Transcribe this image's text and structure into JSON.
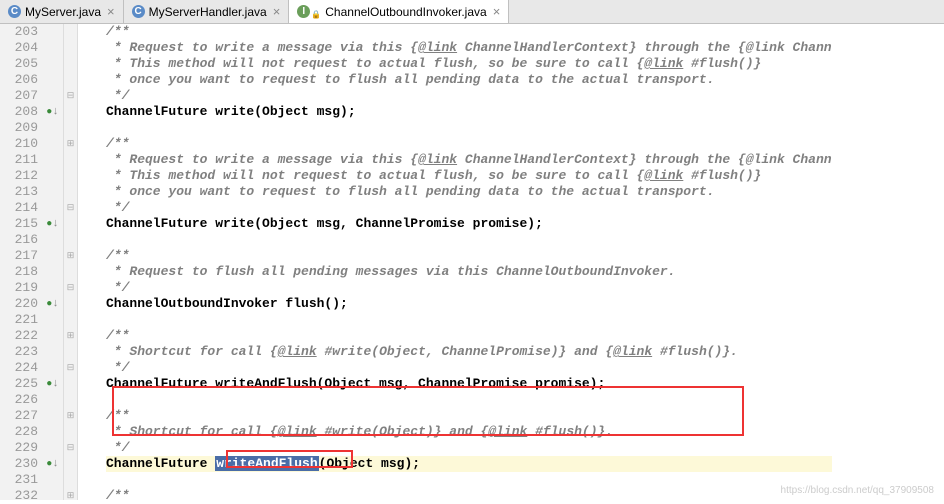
{
  "tabs": [
    {
      "label": "MyServer.java",
      "icon": "c"
    },
    {
      "label": "MyServerHandler.java",
      "icon": "c"
    },
    {
      "label": "ChannelOutboundInvoker.java",
      "icon": "i",
      "active": true
    }
  ],
  "watermark": "https://blog.csdn.net/qq_37909508",
  "lines": [
    {
      "n": "203",
      "m": "",
      "f": "",
      "t": "/**",
      "cls": "comment"
    },
    {
      "n": "204",
      "m": "",
      "f": "",
      "t": " * Request to write a message via this {@link ChannelHandlerContext} through the {@link Chann",
      "cls": "comment",
      "jd": true
    },
    {
      "n": "205",
      "m": "",
      "f": "",
      "t": " * This method will not request to actual flush, so be sure to call {@link #flush()}",
      "cls": "comment",
      "jd": true
    },
    {
      "n": "206",
      "m": "",
      "f": "",
      "t": " * once you want to request to flush all pending data to the actual transport.",
      "cls": "comment"
    },
    {
      "n": "207",
      "m": "",
      "f": "⊟",
      "t": " */",
      "cls": "comment"
    },
    {
      "n": "208",
      "m": "o↓",
      "f": "",
      "t": "ChannelFuture write(Object msg);",
      "cls": "code"
    },
    {
      "n": "209",
      "m": "",
      "f": "",
      "t": "",
      "cls": "code"
    },
    {
      "n": "210",
      "m": "",
      "f": "⊞",
      "t": "/**",
      "cls": "comment"
    },
    {
      "n": "211",
      "m": "",
      "f": "",
      "t": " * Request to write a message via this {@link ChannelHandlerContext} through the {@link Chann",
      "cls": "comment",
      "jd": true
    },
    {
      "n": "212",
      "m": "",
      "f": "",
      "t": " * This method will not request to actual flush, so be sure to call {@link #flush()}",
      "cls": "comment",
      "jd": true
    },
    {
      "n": "213",
      "m": "",
      "f": "",
      "t": " * once you want to request to flush all pending data to the actual transport.",
      "cls": "comment"
    },
    {
      "n": "214",
      "m": "",
      "f": "⊟",
      "t": " */",
      "cls": "comment"
    },
    {
      "n": "215",
      "m": "o↓",
      "f": "",
      "t": "ChannelFuture write(Object msg, ChannelPromise promise);",
      "cls": "code"
    },
    {
      "n": "216",
      "m": "",
      "f": "",
      "t": "",
      "cls": "code"
    },
    {
      "n": "217",
      "m": "",
      "f": "⊞",
      "t": "/**",
      "cls": "comment"
    },
    {
      "n": "218",
      "m": "",
      "f": "",
      "t": " * Request to flush all pending messages via this ChannelOutboundInvoker.",
      "cls": "comment"
    },
    {
      "n": "219",
      "m": "",
      "f": "⊟",
      "t": " */",
      "cls": "comment"
    },
    {
      "n": "220",
      "m": "o↓",
      "f": "",
      "t": "ChannelOutboundInvoker flush();",
      "cls": "code"
    },
    {
      "n": "221",
      "m": "",
      "f": "",
      "t": "",
      "cls": "code"
    },
    {
      "n": "222",
      "m": "",
      "f": "⊞",
      "t": "/**",
      "cls": "comment"
    },
    {
      "n": "223",
      "m": "",
      "f": "",
      "t": " * Shortcut for call {@link #write(Object, ChannelPromise)} and {@link #flush()}.",
      "cls": "comment",
      "jd": true
    },
    {
      "n": "224",
      "m": "",
      "f": "⊟",
      "t": " */",
      "cls": "comment"
    },
    {
      "n": "225",
      "m": "o↓",
      "f": "",
      "t": "ChannelFuture writeAndFlush(Object msg, ChannelPromise promise);",
      "cls": "code"
    },
    {
      "n": "226",
      "m": "",
      "f": "",
      "t": "",
      "cls": "code"
    },
    {
      "n": "227",
      "m": "",
      "f": "⊞",
      "t": "/**",
      "cls": "comment"
    },
    {
      "n": "228",
      "m": "",
      "f": "",
      "t": " * Shortcut for call {@link #write(Object)} and {@link #flush()}.",
      "cls": "comment",
      "jd": true
    },
    {
      "n": "229",
      "m": "",
      "f": "⊟",
      "t": " */",
      "cls": "comment"
    },
    {
      "n": "230",
      "m": "o↓",
      "f": "",
      "t": "ChannelFuture writeAndFlush(Object msg);",
      "cls": "code",
      "hl": true,
      "sel": "writeAndFlush"
    },
    {
      "n": "231",
      "m": "",
      "f": "",
      "t": "",
      "cls": "code"
    },
    {
      "n": "232",
      "m": "",
      "f": "⊞",
      "t": "/**",
      "cls": "comment"
    }
  ]
}
